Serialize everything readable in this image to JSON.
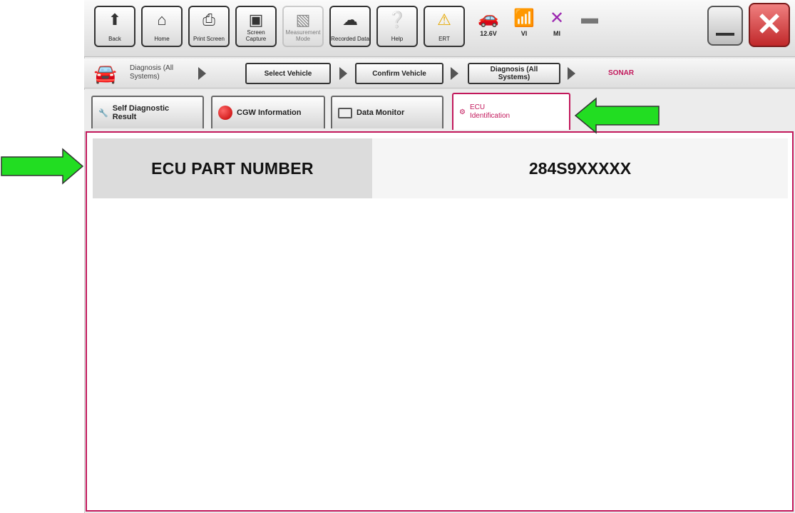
{
  "toolbar": {
    "back_label": "Back",
    "home_label": "Home",
    "print_label": "Print Screen",
    "capture_label": "Screen Capture",
    "measurement_label": "Measurement Mode",
    "recorded_label": "Recorded Data",
    "help_label": "Help",
    "ert_label": "ERT",
    "battery_label": "12.6V",
    "vi_label": "VI",
    "mi_label": "MI"
  },
  "breadcrumb": {
    "current_label": "Diagnosis (All Systems)",
    "steps": [
      "Select Vehicle",
      "Confirm Vehicle",
      "Diagnosis (All Systems)"
    ],
    "system": "SONAR"
  },
  "tabs": [
    "Self Diagnostic Result",
    "CGW Information",
    "Data Monitor",
    "ECU Identification"
  ],
  "ecu": {
    "label": "ECU PART NUMBER",
    "value": "284S9XXXXX"
  },
  "colors": {
    "accent": "#c2185b",
    "arrow": "#22dd22",
    "close": "#d32f2f"
  }
}
